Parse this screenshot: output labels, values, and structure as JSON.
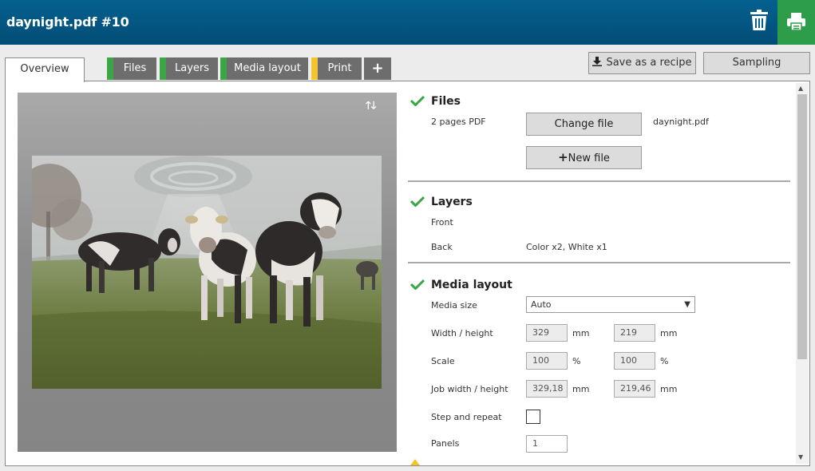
{
  "window": {
    "title": "daynight.pdf #10"
  },
  "header_icons": {
    "trash": "trash-icon",
    "print": "printer-icon"
  },
  "tabs": [
    {
      "label": "Overview",
      "status_color": ""
    },
    {
      "label": "Files",
      "status_color": "#3aa646"
    },
    {
      "label": "Layers",
      "status_color": "#3aa646"
    },
    {
      "label": "Media layout",
      "status_color": "#3aa646"
    },
    {
      "label": "Print",
      "status_color": "#f2c52e"
    },
    {
      "label": "+",
      "status_color": ""
    }
  ],
  "toolbar": {
    "save_recipe": "Save as a recipe",
    "sampling": "Sampling"
  },
  "preview": {
    "arrows": "🡑🡓"
  },
  "files": {
    "title": "Files",
    "info": "2 pages PDF",
    "change_button": "Change file",
    "new_button": "New file",
    "filename": "daynight.pdf"
  },
  "layers": {
    "title": "Layers",
    "front_label": "Front",
    "back_label": "Back",
    "back_value": "Color x2, White x1"
  },
  "media": {
    "title": "Media layout",
    "size_label": "Media size",
    "size_value": "Auto",
    "wh_label": "Width / height",
    "width": "329",
    "height": "219",
    "unit_mm": "mm",
    "scale_label": "Scale",
    "scale_x": "100",
    "scale_y": "100",
    "unit_pct": "%",
    "job_label": "Job width / height",
    "job_width": "329,18",
    "job_height": "219,46",
    "step_label": "Step and repeat",
    "panels_label": "Panels",
    "panels_value": "1"
  },
  "colors": {
    "accent": "#04608f",
    "ok": "#3aa646",
    "warn": "#f2c52e"
  }
}
